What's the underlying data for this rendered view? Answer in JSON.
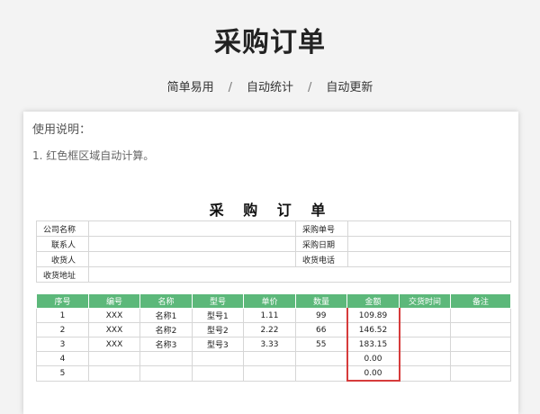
{
  "header": {
    "title": "采购订单",
    "features": [
      "简单易用",
      "自动统计",
      "自动更新"
    ],
    "separator": "/"
  },
  "usage": {
    "title": "使用说明：",
    "note": "1. 红色框区域自动计算。"
  },
  "form": {
    "title": "采 购 订 单",
    "fields": {
      "company": "公司名称",
      "contact": "联系人",
      "receiver": "收货人",
      "address": "收货地址",
      "order_no": "采购单号",
      "order_date": "采购日期",
      "phone": "收货电话"
    }
  },
  "table": {
    "headers": [
      "序号",
      "编号",
      "名称",
      "型号",
      "单价",
      "数量",
      "金额",
      "交货时间",
      "备注"
    ],
    "rows": [
      [
        "1",
        "XXX",
        "名称1",
        "型号1",
        "1.11",
        "99",
        "109.89",
        "",
        ""
      ],
      [
        "2",
        "XXX",
        "名称2",
        "型号2",
        "2.22",
        "66",
        "146.52",
        "",
        ""
      ],
      [
        "3",
        "XXX",
        "名称3",
        "型号3",
        "3.33",
        "55",
        "183.15",
        "",
        ""
      ],
      [
        "4",
        "",
        "",
        "",
        "",
        "",
        "0.00",
        "",
        ""
      ],
      [
        "5",
        "",
        "",
        "",
        "",
        "",
        "0.00",
        "",
        ""
      ]
    ]
  },
  "colors": {
    "header_green": "#5cb87a",
    "highlight_red": "#d63b3b"
  }
}
